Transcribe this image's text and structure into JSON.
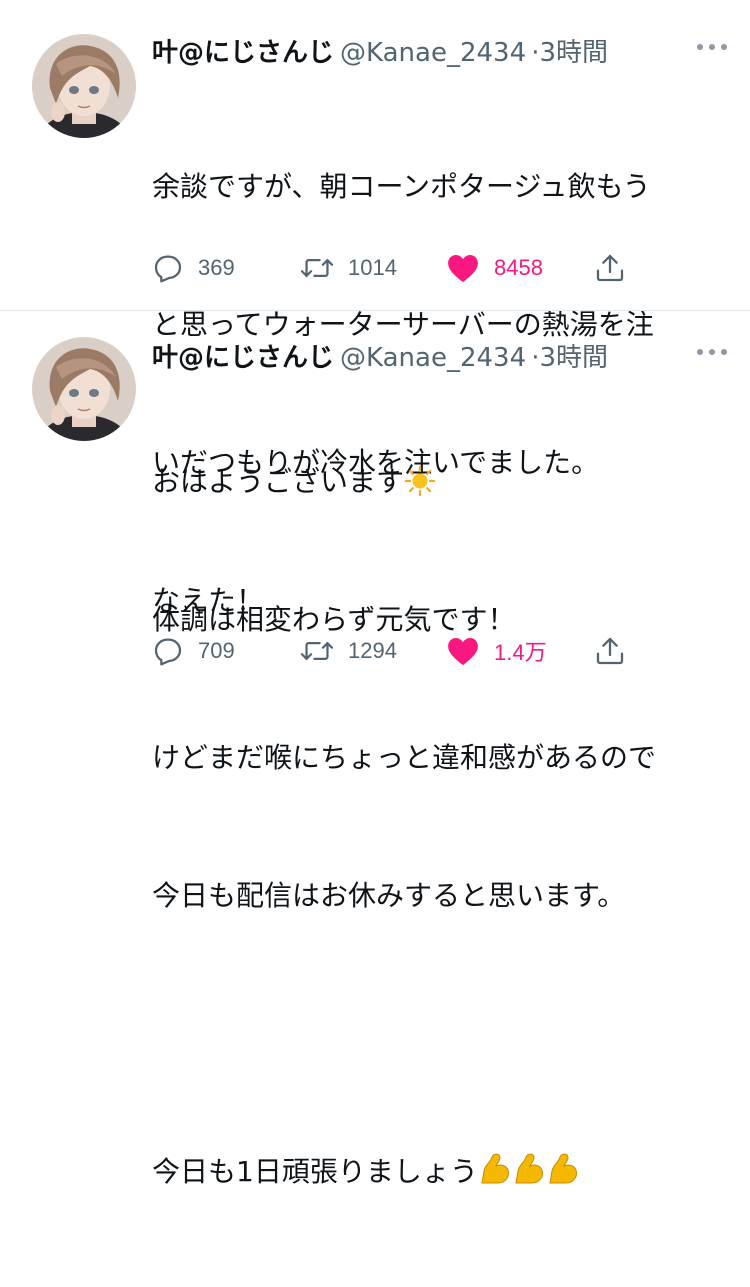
{
  "tweets": [
    {
      "author_name": "叶@にじさんじ",
      "handle": "@Kanae_2434",
      "separator": "·",
      "time": "3時間",
      "body_lines": [
        "余談ですが、朝コーンポタージュ飲もう",
        "と思ってウォーターサーバーの熱湯を注",
        "いだつもりが冷水を注いでました。",
        "なえた！"
      ],
      "replies": "369",
      "retweets": "1014",
      "likes": "8458",
      "liked": true
    },
    {
      "author_name": "叶@にじさんじ",
      "handle": "@Kanae_2434",
      "separator": "·",
      "time": "3時間",
      "body_lines": [
        "おはようございます",
        "体調は相変わらず元気です！",
        "けどまだ喉にちょっと違和感があるので",
        "今日も配信はお休みすると思います。",
        "",
        "今日も1日頑張りましょう"
      ],
      "body_emojis": {
        "line_0": "sun-emoji",
        "line_5": "flexed-biceps-emoji x3"
      },
      "replies": "709",
      "retweets": "1294",
      "likes": "1.4万",
      "liked": true
    }
  ],
  "colors": {
    "text": "#0f1419",
    "secondary": "#536471",
    "like": "#f91880",
    "divider": "#e1e8ed"
  },
  "icons": {
    "reply": "reply-icon",
    "retweet": "retweet-icon",
    "like": "heart-icon",
    "share": "share-icon",
    "more": "more-dots-icon"
  }
}
